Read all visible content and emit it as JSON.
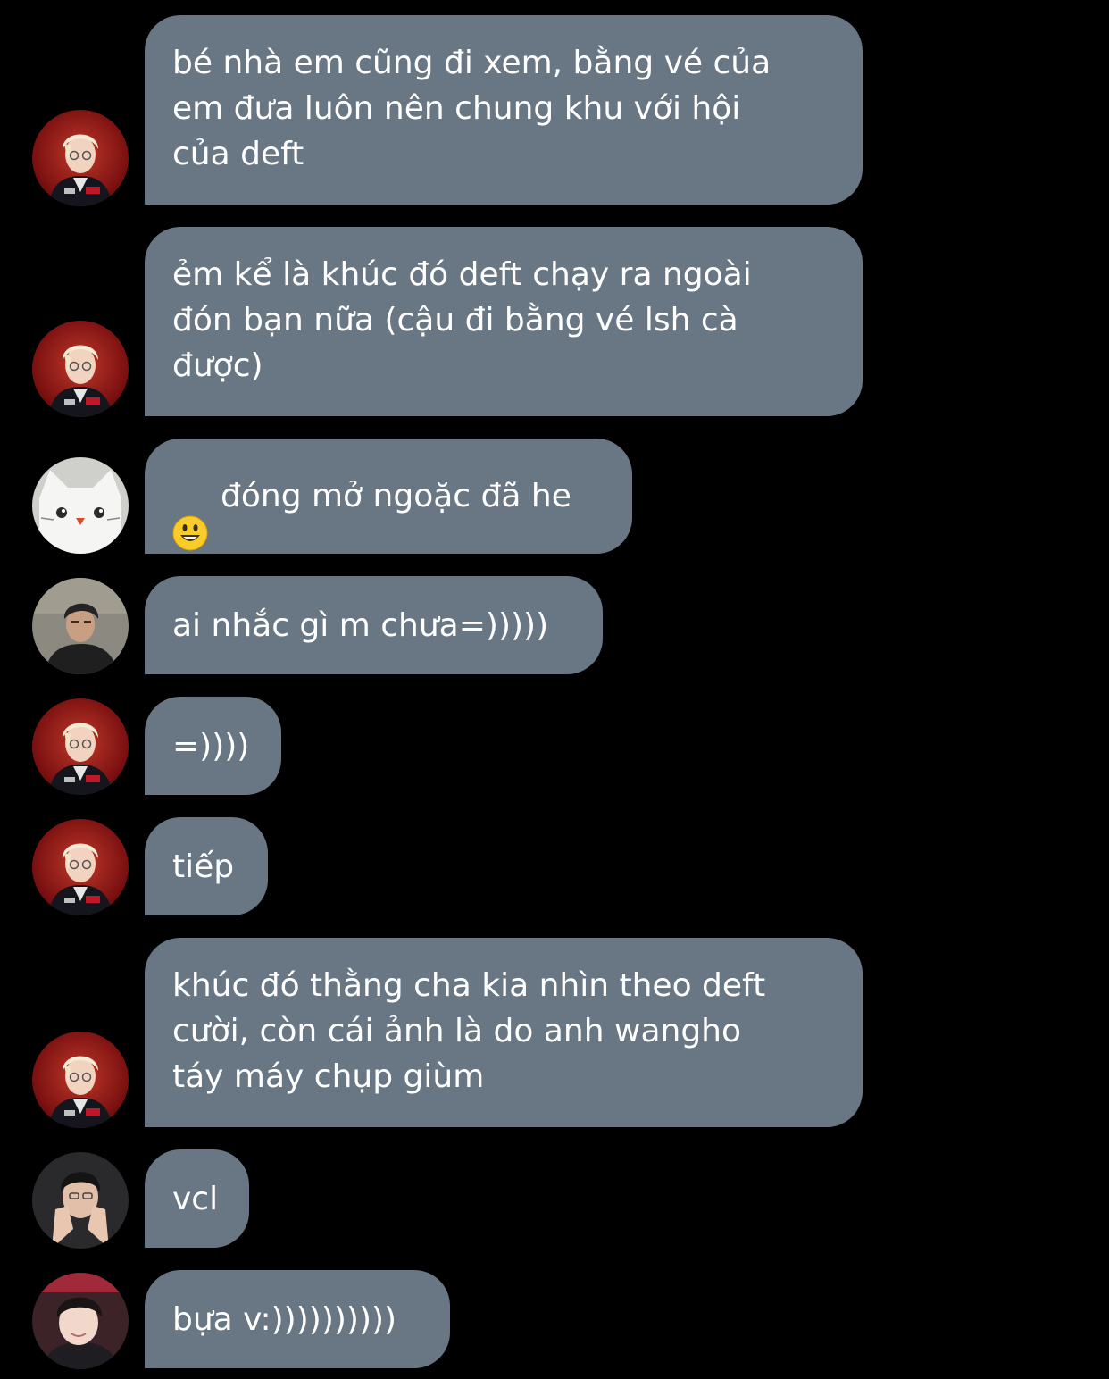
{
  "conversation": {
    "messages": [
      {
        "sender": "deft-red",
        "text": "bé nhà em cũng đi xem, bằng vé của\nem đưa luôn nên chung khu với hội\ncủa deft"
      },
      {
        "sender": "deft-red",
        "text": "ẻm kể là khúc đó deft chạy ra ngoài\nđón bạn nữa (cậu đi bằng vé lsh cà\nđược)"
      },
      {
        "sender": "cat",
        "emoji": "smiley-icon",
        "text": "đóng mở ngoặc đã he"
      },
      {
        "sender": "portrait-dark",
        "text": "ai nhắc gì m chưa=)))))"
      },
      {
        "sender": "deft-red",
        "text": "=))))"
      },
      {
        "sender": "deft-red",
        "text": "tiếp"
      },
      {
        "sender": "deft-red",
        "text": "khúc đó thằng cha kia nhìn theo deft\ncười, còn cái ảnh là do anh wangho\ntáy máy chụp giùm"
      },
      {
        "sender": "portrait-hands",
        "text": "vcl"
      },
      {
        "sender": "portrait-smile",
        "text": "bựa v:))))))))))"
      }
    ]
  },
  "colors": {
    "background": "#000000",
    "bubble": "#697684",
    "text": "#ffffff"
  }
}
